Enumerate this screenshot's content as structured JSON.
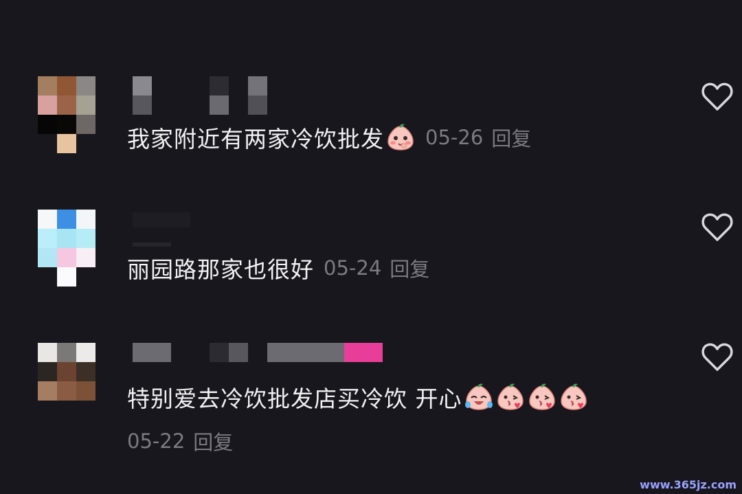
{
  "comments": [
    {
      "text": "我家附近有两家冷饮批发",
      "emojis": [
        "shy-peach-emoji"
      ],
      "date": "05-26",
      "reply_label": "回复"
    },
    {
      "text": "丽园路那家也很好",
      "emojis": [],
      "date": "05-24",
      "reply_label": "回复"
    },
    {
      "text": "特别爱去冷饮批发店买冷饮 开心",
      "emojis": [
        "laugh-cry-peach-emoji",
        "kiss-peach-emoji",
        "kiss-peach-emoji",
        "kiss-peach-emoji"
      ],
      "date": "05-22",
      "reply_label": "回复"
    }
  ],
  "like_icon": "heart-outline-icon",
  "watermark": "www.365jz.com",
  "colors": {
    "background": "#18171d",
    "text": "#f2f2f4",
    "meta": "#7c7b82",
    "accent_pink": "#e83e9a"
  }
}
